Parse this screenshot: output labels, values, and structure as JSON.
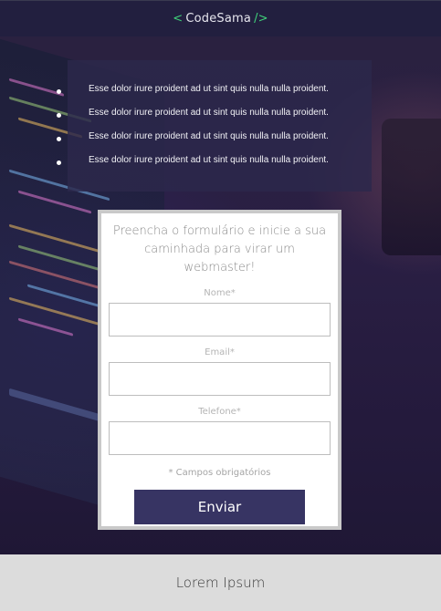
{
  "header": {
    "brand_open": "<",
    "brand_name": "CodeSama",
    "brand_close": "/>",
    "brand_color": "#3fd17a"
  },
  "bullets": {
    "items": [
      "Esse dolor irure proident ad ut sint quis nulla nulla proident.",
      "Esse dolor irure proident ad ut sint quis nulla nulla proident.",
      "Esse dolor irure proident ad ut sint quis nulla nulla proident.",
      "Esse dolor irure proident ad ut sint quis nulla nulla proident."
    ]
  },
  "form": {
    "title": "Preencha o formulário e inicie a sua caminhada para virar um webmaster!",
    "fields": {
      "name_label": "Nome*",
      "name_value": "",
      "email_label": "Email*",
      "email_value": "",
      "phone_label": "Telefone*",
      "phone_value": ""
    },
    "required_note": "* Campos obrigatórios",
    "submit_label": "Enviar",
    "button_color": "#373463"
  },
  "footer": {
    "text": "Lorem Ipsum"
  }
}
